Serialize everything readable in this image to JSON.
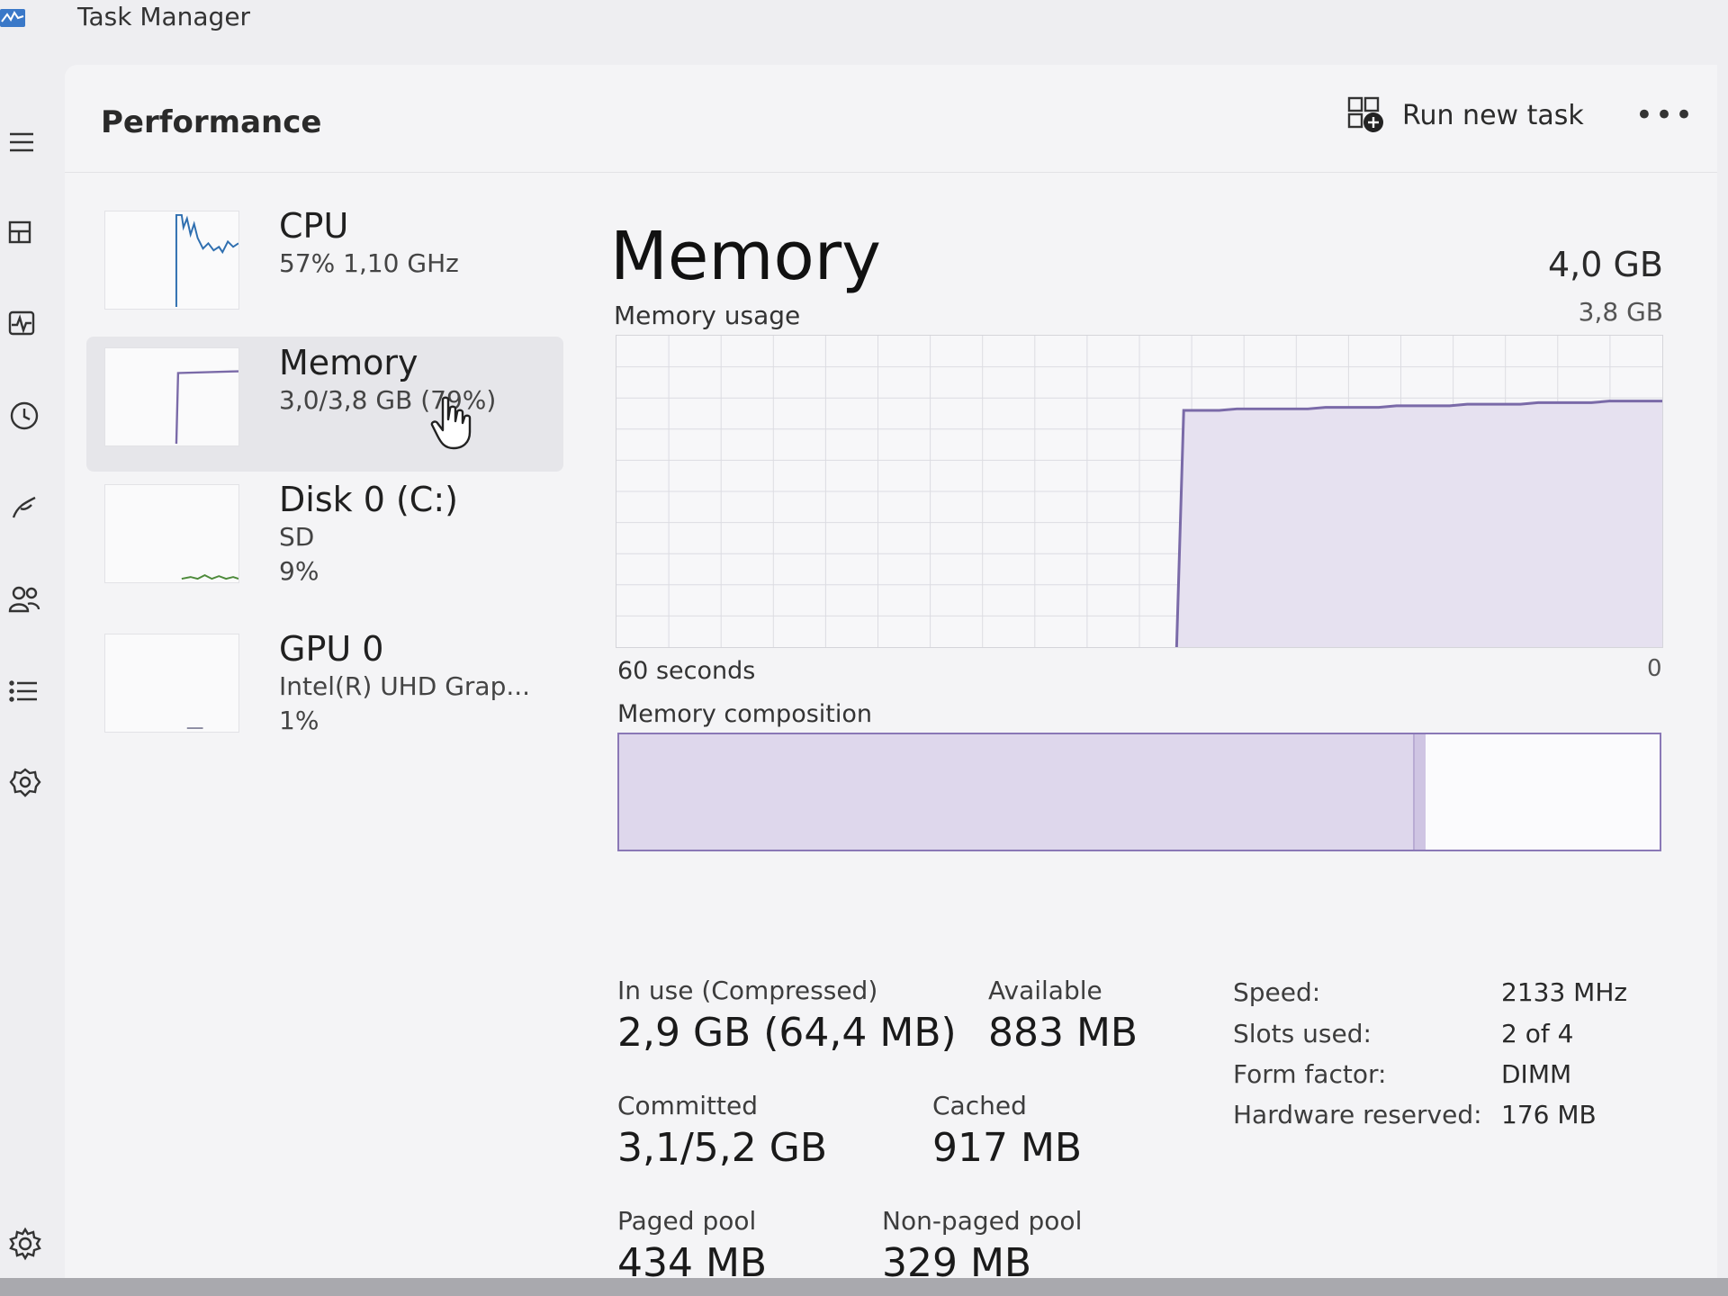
{
  "window": {
    "title": "Task Manager"
  },
  "nav": {
    "items": [
      {
        "name": "menu-icon"
      },
      {
        "name": "processes-icon"
      },
      {
        "name": "performance-icon"
      },
      {
        "name": "app-history-icon"
      },
      {
        "name": "startup-apps-icon"
      },
      {
        "name": "users-icon"
      },
      {
        "name": "details-icon"
      },
      {
        "name": "services-icon"
      }
    ],
    "settings": {
      "name": "settings-icon"
    }
  },
  "header": {
    "title": "Performance",
    "run_new_task": "Run new task",
    "more": "•••"
  },
  "devices": [
    {
      "name": "CPU",
      "line1": "57% 1,10 GHz",
      "line2": ""
    },
    {
      "name": "Memory",
      "line1": "3,0/3,8 GB (79%)",
      "line2": ""
    },
    {
      "name": "Disk 0 (C:)",
      "line1": "SD",
      "line2": "9%"
    },
    {
      "name": "GPU 0",
      "line1": "Intel(R) UHD Grap...",
      "line2": "1%"
    }
  ],
  "memory": {
    "title": "Memory",
    "total": "4,0 GB",
    "usage_label": "Memory usage",
    "usage_max": "3,8 GB",
    "time_span": "60 seconds",
    "time_zero": "0",
    "composition_label": "Memory composition",
    "composition": {
      "in_use_fraction": 0.765,
      "modified_fraction": 0.01
    },
    "usage_history": [
      0,
      0,
      0,
      0,
      0,
      0,
      0,
      0,
      0,
      0,
      0,
      0,
      0,
      0,
      0,
      0,
      0,
      0,
      0,
      0,
      0,
      0,
      0,
      0,
      0,
      0,
      0,
      0,
      0,
      0,
      0,
      0,
      0.76,
      0.76,
      0.76,
      0.765,
      0.765,
      0.765,
      0.765,
      0.765,
      0.77,
      0.77,
      0.77,
      0.77,
      0.775,
      0.775,
      0.775,
      0.775,
      0.78,
      0.78,
      0.78,
      0.78,
      0.785,
      0.785,
      0.785,
      0.785,
      0.79,
      0.79,
      0.79,
      0.79
    ],
    "stats": {
      "in_use_label": "In use (Compressed)",
      "in_use_value": "2,9 GB (64,4 MB)",
      "available_label": "Available",
      "available_value": "883 MB",
      "committed_label": "Committed",
      "committed_value": "3,1/5,2 GB",
      "cached_label": "Cached",
      "cached_value": "917 MB",
      "paged_label": "Paged pool",
      "paged_value": "434 MB",
      "nonpaged_label": "Non-paged pool",
      "nonpaged_value": "329 MB"
    },
    "specs": {
      "speed_label": "Speed:",
      "speed_value": "2133 MHz",
      "slots_label": "Slots used:",
      "slots_value": "2 of 4",
      "form_label": "Form factor:",
      "form_value": "DIMM",
      "reserved_label": "Hardware reserved:",
      "reserved_value": "176 MB"
    }
  },
  "colors": {
    "accent": "#7a6aa8",
    "graph_fill": "#e6e1f0",
    "cpu_line": "#2f6fb0",
    "disk_line": "#4d8a3a"
  }
}
